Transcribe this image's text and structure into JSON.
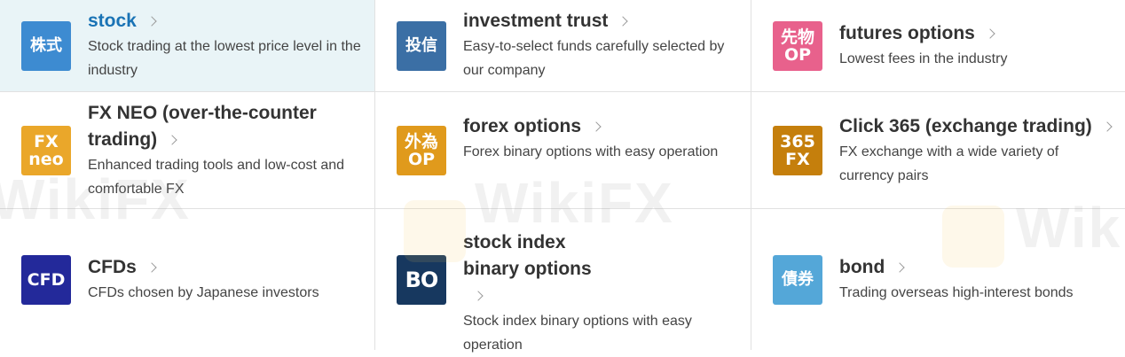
{
  "products": [
    {
      "icon": {
        "name": "stock-icon",
        "lines": [
          "株式"
        ],
        "color": "#3d8bd1"
      },
      "title": "stock",
      "description": "Stock trading at the lowest price level in the industry",
      "active": true
    },
    {
      "icon": {
        "name": "investment-trust-icon",
        "lines": [
          "投信"
        ],
        "color": "#3b6fa5"
      },
      "title": "investment trust",
      "description": "Easy-to-select funds carefully selected by our company",
      "active": false
    },
    {
      "icon": {
        "name": "futures-options-icon",
        "lines": [
          "先物",
          "OP"
        ],
        "color": "#e8618c"
      },
      "title": "futures options",
      "description": "Lowest fees in the industry",
      "active": false
    },
    {
      "icon": {
        "name": "fx-neo-icon",
        "lines": [
          "FX",
          "neo"
        ],
        "color": "#eaa72a"
      },
      "title": "FX NEO (over-the-counter trading)",
      "description": "Enhanced trading tools and low-cost and comfortable FX",
      "active": false
    },
    {
      "icon": {
        "name": "forex-options-icon",
        "lines": [
          "外為",
          "OP"
        ],
        "color": "#e09a1c"
      },
      "title": "forex options",
      "description": "Forex binary options with easy operation",
      "active": false
    },
    {
      "icon": {
        "name": "click-365-icon",
        "lines": [
          "365",
          "FX"
        ],
        "color": "#c57f0c"
      },
      "title": "Click 365 (exchange trading)",
      "description": "FX exchange with a wide variety of currency pairs",
      "active": false
    },
    {
      "icon": {
        "name": "cfd-icon",
        "lines": [
          "CFD"
        ],
        "color": "#23299a"
      },
      "title": "CFDs",
      "description": "CFDs chosen by Japanese investors",
      "active": false
    },
    {
      "icon": {
        "name": "bo-icon",
        "lines": [
          "BO"
        ],
        "color": "#17385f"
      },
      "title": "stock index binary options",
      "description": "Stock index binary options with easy operation",
      "active": false
    },
    {
      "icon": {
        "name": "bond-icon",
        "lines": [
          "債券"
        ],
        "color": "#54a7d8"
      },
      "title": "bond",
      "description": "Trading overseas high-interest bonds",
      "active": false
    }
  ],
  "watermark": "WikiFX"
}
